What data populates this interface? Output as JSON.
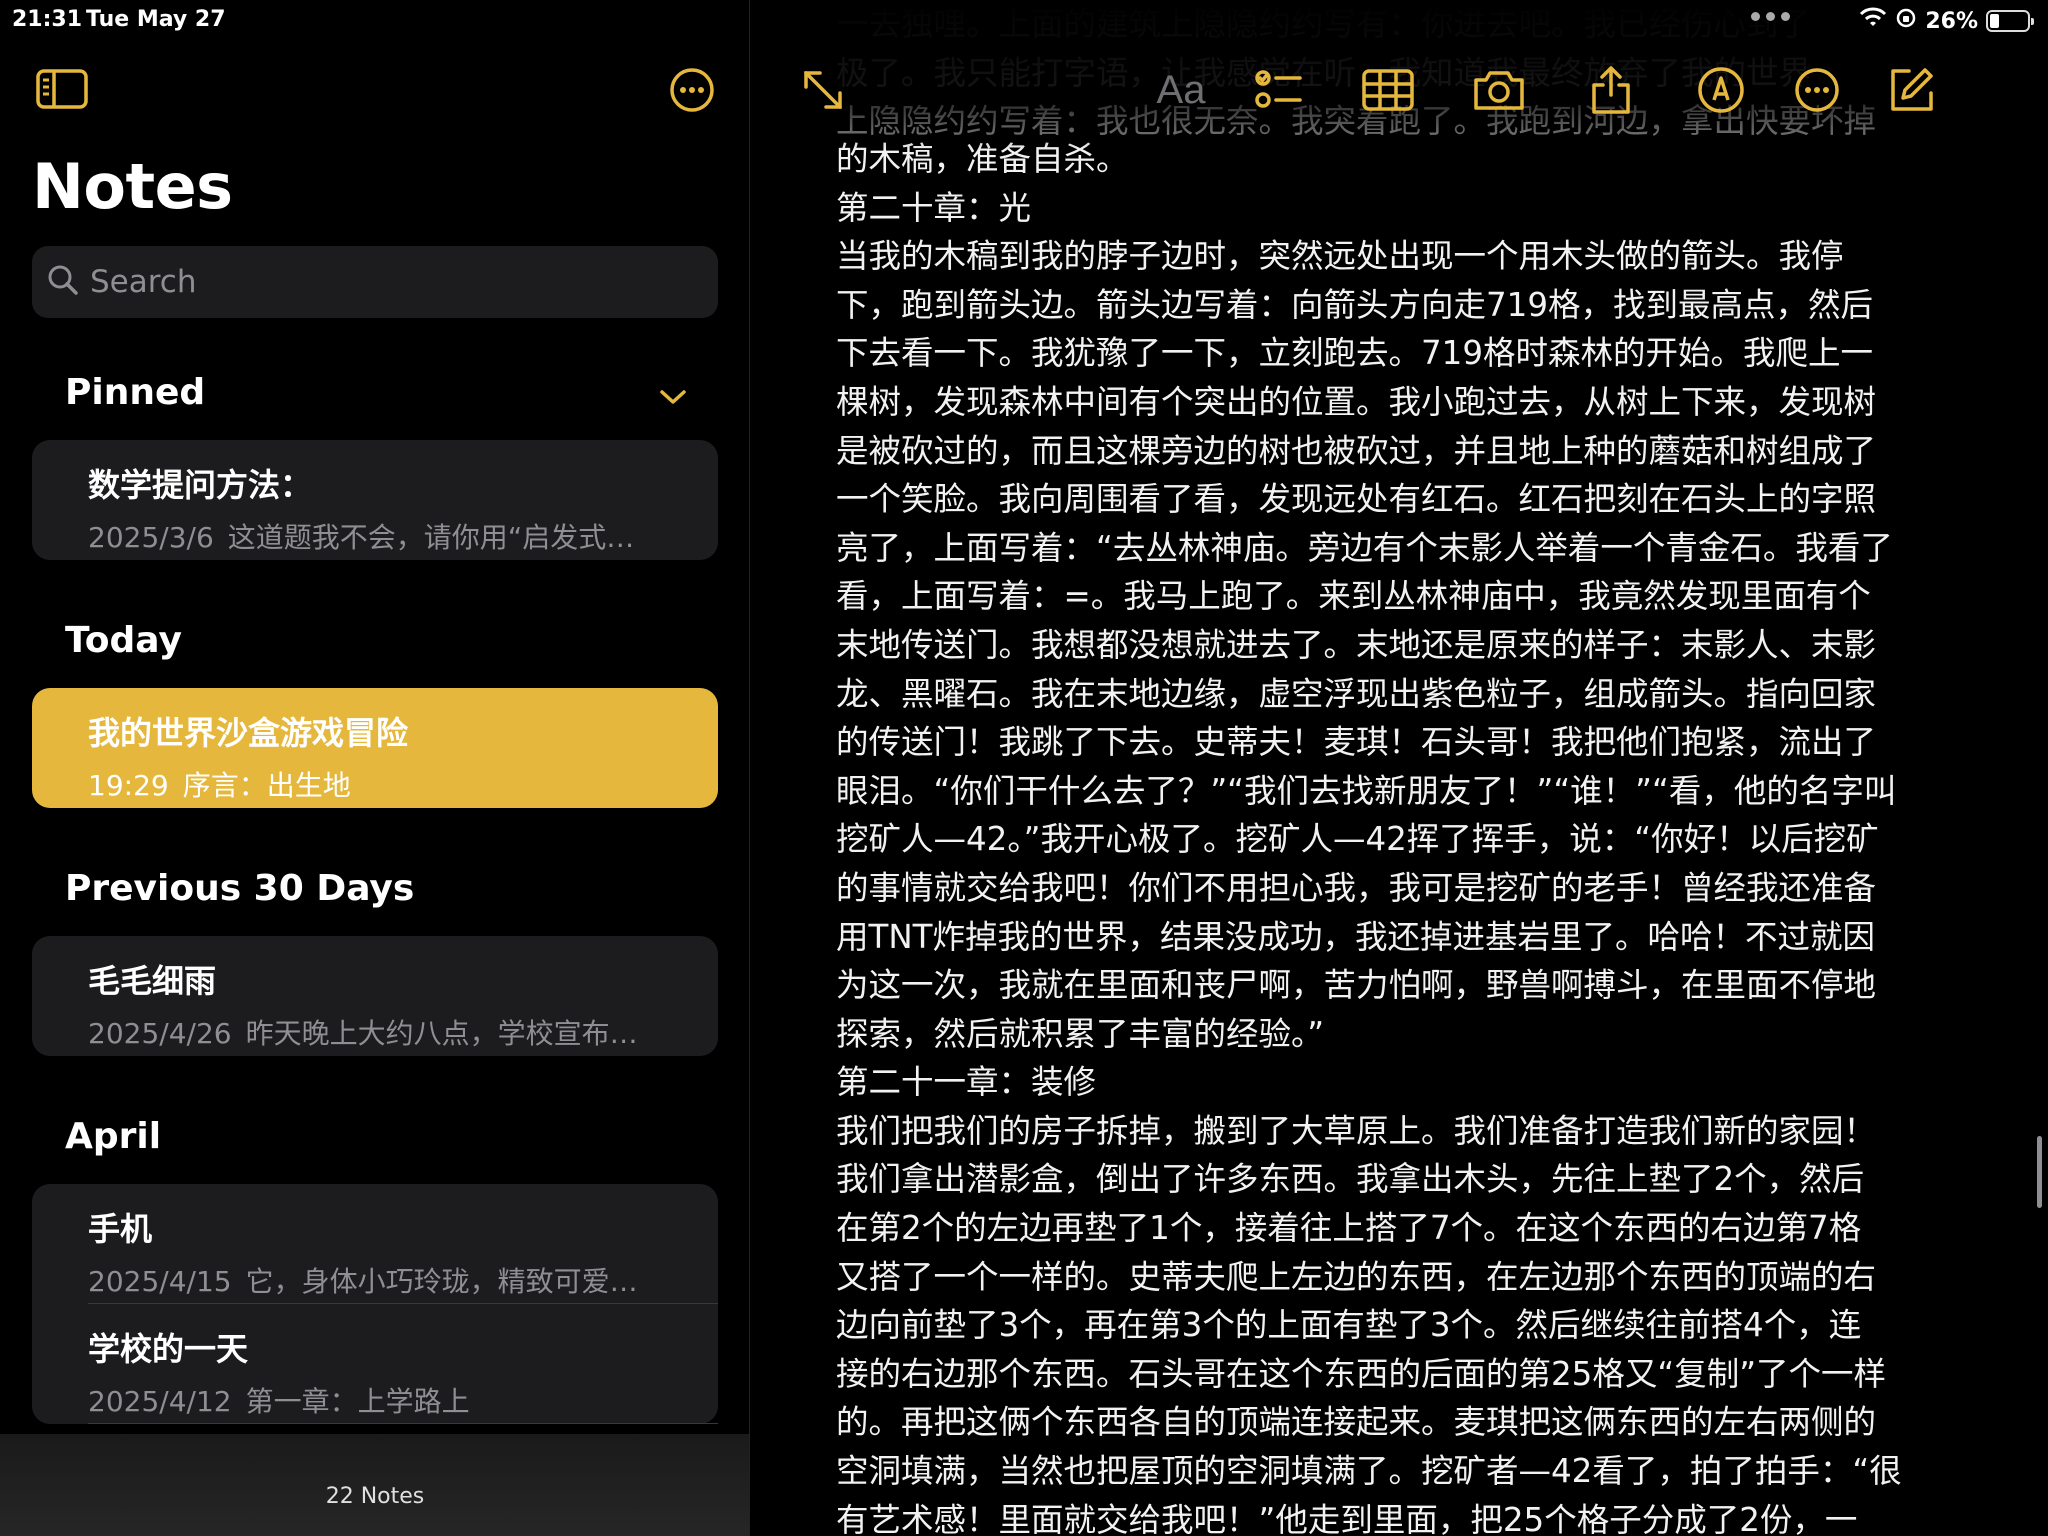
{
  "status": {
    "time": "21:31",
    "date": "Tue May 27",
    "battery": "26%",
    "battery_level": 0.26
  },
  "sidebar": {
    "title": "Notes",
    "search_placeholder": "Search",
    "sections": {
      "pinned": "Pinned",
      "today": "Today",
      "previous": "Previous 30 Days",
      "april": "April"
    },
    "pinned_notes": [
      {
        "title": "数学提问方法：",
        "date": "2025/3/6",
        "preview": "这道题我不会，请你用“启发式…"
      }
    ],
    "today_notes": [
      {
        "title": "我的世界沙盒游戏冒险",
        "date": "19:29",
        "preview": "序言：出生地"
      }
    ],
    "previous_notes": [
      {
        "title": "毛毛细雨",
        "date": "2025/4/26",
        "preview": "昨天晚上大约八点，学校宣布…"
      }
    ],
    "april_notes": [
      {
        "title": "手机",
        "date": "2025/4/15",
        "preview": "它，身体小巧玲珑，精致可爱…"
      },
      {
        "title": "学校的一天",
        "date": "2025/4/12",
        "preview": "第一章：上学路上"
      }
    ],
    "footer": "22 Notes"
  },
  "editor": {
    "toolbar": {
      "format": "Aa"
    },
    "ghost_lines": [
      "一去独哩。上面的建筑上隐隐约约写有：你进去吧。我已经伤心到了",
      "极了。我只能打字语，让我感觉在听，我知道我最终放弃了我的世界",
      "上隐隐约约写着：我也很无奈。我突着跑了。我跑到河边，拿出快要坏掉"
    ],
    "lines": [
      "的木稿，准备自杀。",
      "第二十章：光",
      "  当我的木稿到我的脖子边时，突然远处出现一个用木头做的箭头。我停",
      "下，跑到箭头边。箭头边写着：向箭头方向走719格，找到最高点，然后",
      "下去看一下。我犹豫了一下，立刻跑去。719格时森林的开始。我爬上一",
      "棵树，发现森林中间有个突出的位置。我小跑过去，从树上下来，发现树",
      "是被砍过的，而且这棵旁边的树也被砍过，并且地上种的蘑菇和树组成了",
      "一个笑脸。我向周围看了看，发现远处有红石。红石把刻在石头上的字照",
      "亮了，上面写着：“去丛林神庙。旁边有个末影人举着一个青金石。我看了",
      "看，上面写着：=。我马上跑了。来到丛林神庙中，我竟然发现里面有个",
      "末地传送门。我想都没想就进去了。末地还是原来的样子：末影人、末影",
      "龙、黑曜石。我在末地边缘，虚空浮现出紫色粒子，组成箭头。指向回家",
      "的传送门！我跳了下去。史蒂夫！麦琪！石头哥！我把他们抱紧，流出了",
      "眼泪。“你们干什么去了？”“我们去找新朋友了！”“谁！”“看，他的名字叫",
      "挖矿人—42。”我开心极了。挖矿人—42挥了挥手，说：“你好！以后挖矿",
      "的事情就交给我吧！你们不用担心我，我可是挖矿的老手！曾经我还准备",
      "用TNT炸掉我的世界，结果没成功，我还掉进基岩里了。哈哈！不过就因",
      "为这一次，我就在里面和丧尸啊，苦力怕啊，野兽啊搏斗，在里面不停地",
      "探索，然后就积累了丰富的经验。”",
      "第二十一章：装修",
      "  我们把我们的房子拆掉，搬到了大草原上。我们准备打造我们新的家园！",
      "我们拿出潜影盒，倒出了许多东西。我拿出木头，先往上垫了2个，然后",
      "在第2个的左边再垫了1个，接着往上搭了7个。在这个东西的右边第7格",
      "又搭了一个一样的。史蒂夫爬上左边的东西，在左边那个东西的顶端的右",
      "边向前垫了3个，再在第3个的上面有垫了3个。然后继续往前搭4个，连",
      "接的右边那个东西。石头哥在这个东西的后面的第25格又“复制”了个一样",
      "的。再把这俩个东西各自的顶端连接起来。麦琪把这俩东西的左右两侧的",
      "空洞填满，当然也把屋顶的空洞填满了。挖矿者—42看了，拍了拍手：“很",
      "有艺术感！里面就交给我吧！”他走到里面，把25个格子分成了2份，一"
    ]
  }
}
